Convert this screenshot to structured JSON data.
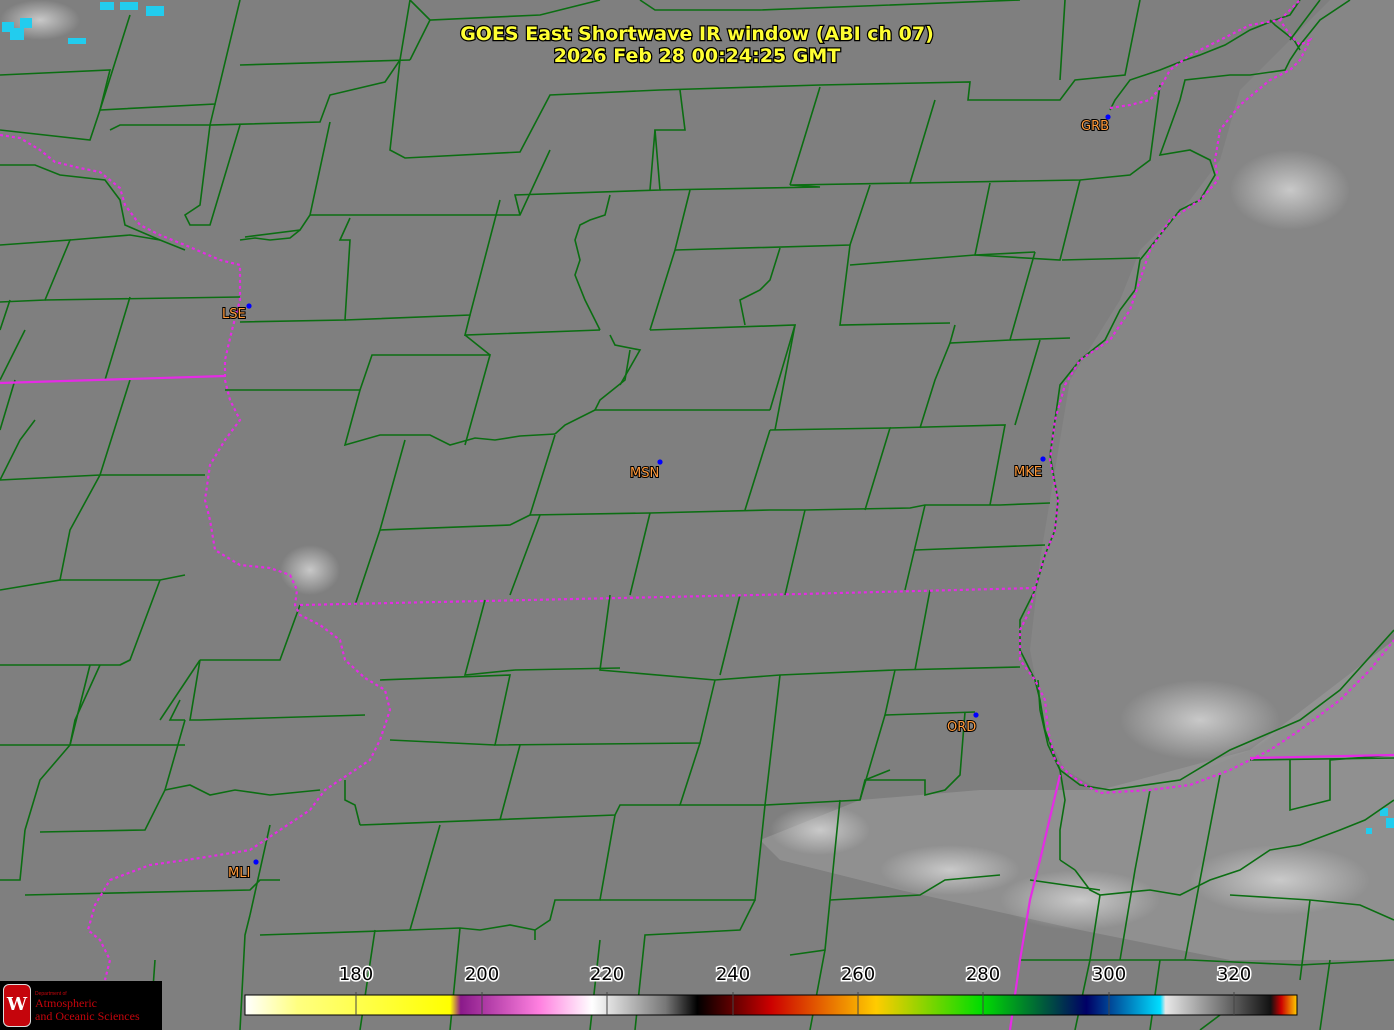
{
  "title": {
    "line1": "GOES East Shortwave IR window (ABI ch 07)",
    "line2": "2026 Feb 28  00:24:25 GMT"
  },
  "stations": [
    {
      "id": "GRB"
    },
    {
      "id": "LSE"
    },
    {
      "id": "MSN"
    },
    {
      "id": "MKE"
    },
    {
      "id": "ORD"
    },
    {
      "id": "MLI"
    }
  ],
  "colorbar": {
    "ticks": [
      "180",
      "200",
      "220",
      "240",
      "260",
      "280",
      "300",
      "320"
    ],
    "colors": {
      "cold_yellow": "#ffff00",
      "magenta": "#cc2fbf",
      "red": "#cc0000",
      "green": "#22cc00",
      "blue": "#001080",
      "cyan": "#00ddff",
      "warm_black": "#111111"
    }
  },
  "logo": {
    "small_text": "Department of",
    "line1": "Atmospheric",
    "line2": "and Oceanic Sciences",
    "seal_letter": "W"
  },
  "colors": {
    "county_lines": "#0b6e12",
    "state_lines": "#e52be5",
    "title": "#ffff33",
    "station_labels": "#ff9a3c",
    "station_dots": "#0000ff"
  }
}
